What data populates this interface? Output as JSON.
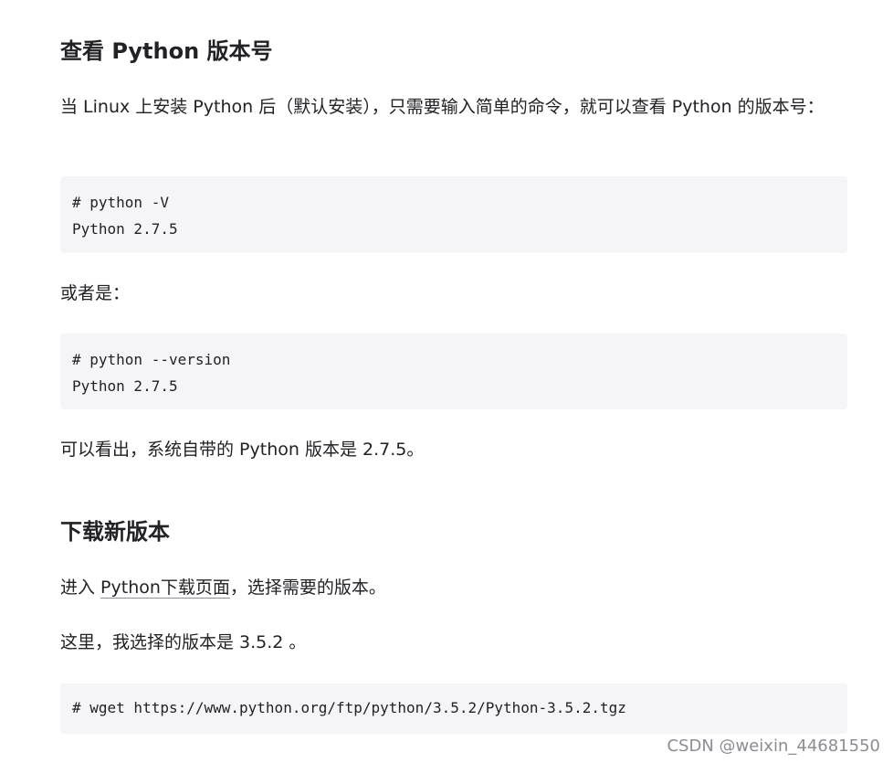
{
  "section1": {
    "title": "查看 Python 版本号",
    "intro": "当 Linux 上安装 Python 后（默认安装），只需要输入简单的命令，就可以查看 Python 的版本号：",
    "code1": "# python -V\nPython 2.7.5",
    "or_text": "或者是：",
    "code2": "# python --version\nPython 2.7.5",
    "conclusion": "可以看出，系统自带的 Python 版本是 2.7.5。"
  },
  "section2": {
    "title": "下载新版本",
    "enter_prefix": "进入 ",
    "link_label": "Python下载页面",
    "enter_suffix": "，选择需要的版本。",
    "choose_text": "这里，我选择的版本是 3.5.2 。",
    "code3": "# wget https://www.python.org/ftp/python/3.5.2/Python-3.5.2.tgz"
  },
  "watermark": "CSDN @weixin_44681550"
}
